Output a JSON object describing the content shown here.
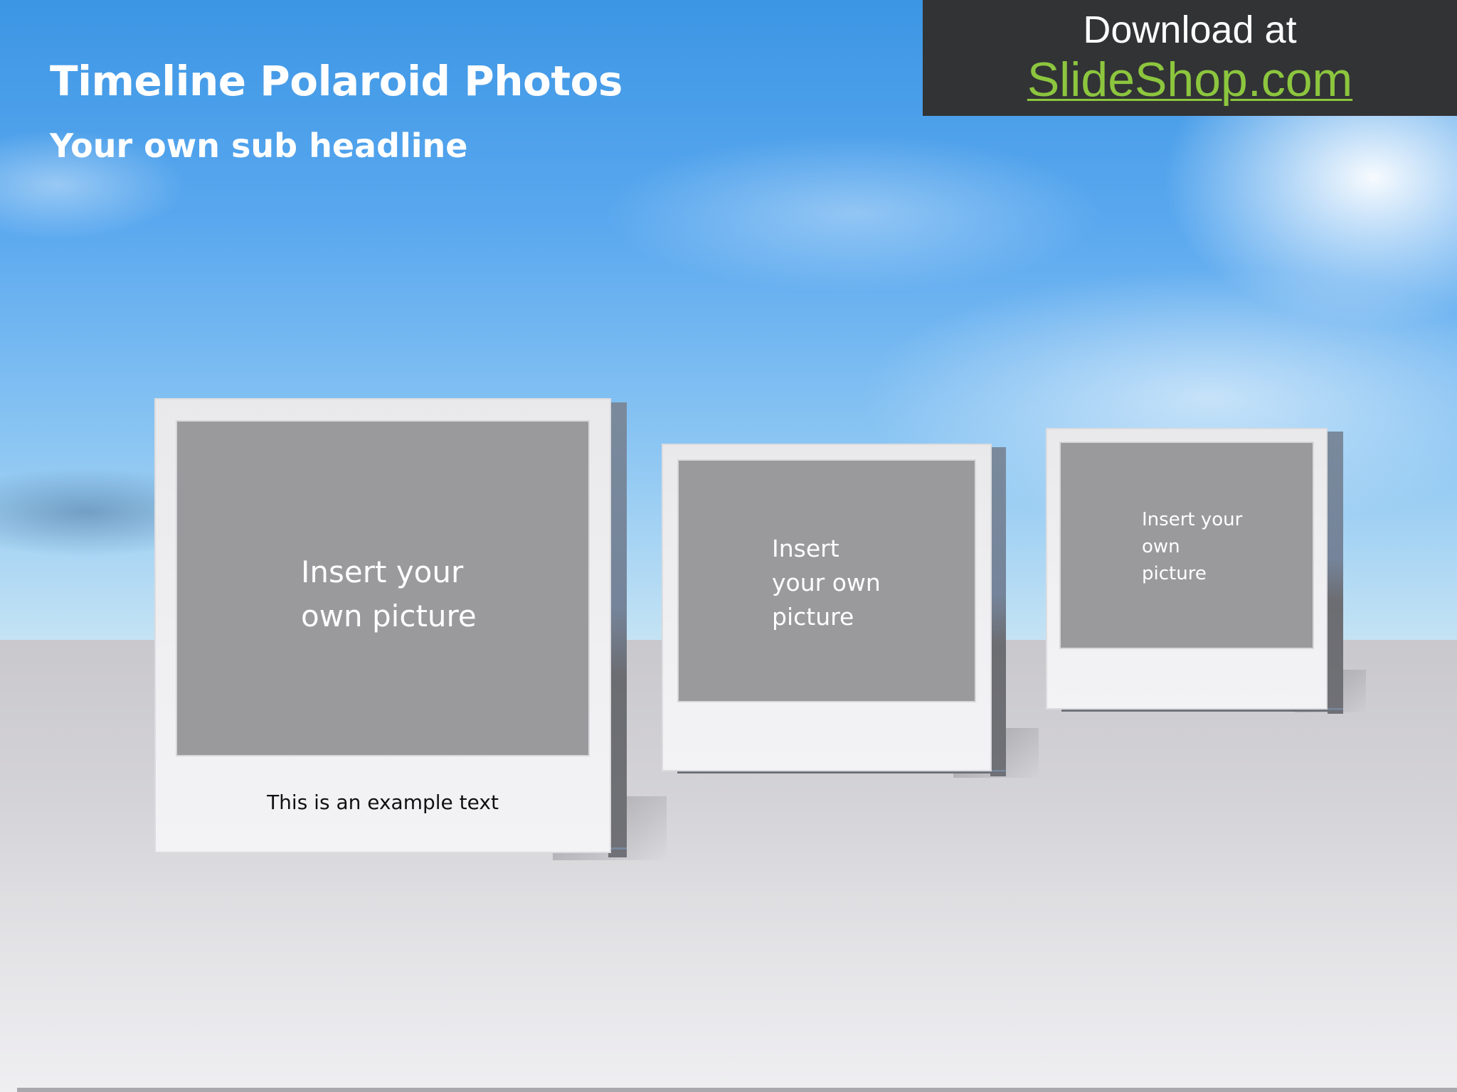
{
  "slide": {
    "title": "Timeline Polaroid Photos",
    "subtitle": "Your own sub headline"
  },
  "banner": {
    "line1": "Download at",
    "line2": "SlideShop.com",
    "link_color": "#8cc63e",
    "background_color": "#323335"
  },
  "polaroids": [
    {
      "placeholder_text": "Insert your\nown picture",
      "caption": "This is an example text"
    },
    {
      "placeholder_text": "Insert\nyour own\npicture",
      "caption": ""
    },
    {
      "placeholder_text": "Insert your\nown\npicture",
      "caption": ""
    }
  ],
  "colors": {
    "title_text": "#ffffff",
    "photo_placeholder": "#9a999c",
    "frame": "#f0f0f2"
  }
}
